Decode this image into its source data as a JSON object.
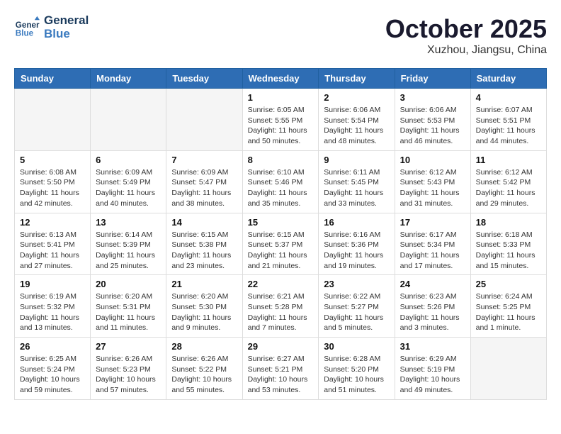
{
  "header": {
    "logo_line1": "General",
    "logo_line2": "Blue",
    "month_title": "October 2025",
    "location": "Xuzhou, Jiangsu, China"
  },
  "days_of_week": [
    "Sunday",
    "Monday",
    "Tuesday",
    "Wednesday",
    "Thursday",
    "Friday",
    "Saturday"
  ],
  "weeks": [
    [
      {
        "day": "",
        "empty": true
      },
      {
        "day": "",
        "empty": true
      },
      {
        "day": "",
        "empty": true
      },
      {
        "day": "1",
        "sunrise": "6:05 AM",
        "sunset": "5:55 PM",
        "daylight": "11 hours and 50 minutes."
      },
      {
        "day": "2",
        "sunrise": "6:06 AM",
        "sunset": "5:54 PM",
        "daylight": "11 hours and 48 minutes."
      },
      {
        "day": "3",
        "sunrise": "6:06 AM",
        "sunset": "5:53 PM",
        "daylight": "11 hours and 46 minutes."
      },
      {
        "day": "4",
        "sunrise": "6:07 AM",
        "sunset": "5:51 PM",
        "daylight": "11 hours and 44 minutes."
      }
    ],
    [
      {
        "day": "5",
        "sunrise": "6:08 AM",
        "sunset": "5:50 PM",
        "daylight": "11 hours and 42 minutes."
      },
      {
        "day": "6",
        "sunrise": "6:09 AM",
        "sunset": "5:49 PM",
        "daylight": "11 hours and 40 minutes."
      },
      {
        "day": "7",
        "sunrise": "6:09 AM",
        "sunset": "5:47 PM",
        "daylight": "11 hours and 38 minutes."
      },
      {
        "day": "8",
        "sunrise": "6:10 AM",
        "sunset": "5:46 PM",
        "daylight": "11 hours and 35 minutes."
      },
      {
        "day": "9",
        "sunrise": "6:11 AM",
        "sunset": "5:45 PM",
        "daylight": "11 hours and 33 minutes."
      },
      {
        "day": "10",
        "sunrise": "6:12 AM",
        "sunset": "5:43 PM",
        "daylight": "11 hours and 31 minutes."
      },
      {
        "day": "11",
        "sunrise": "6:12 AM",
        "sunset": "5:42 PM",
        "daylight": "11 hours and 29 minutes."
      }
    ],
    [
      {
        "day": "12",
        "sunrise": "6:13 AM",
        "sunset": "5:41 PM",
        "daylight": "11 hours and 27 minutes."
      },
      {
        "day": "13",
        "sunrise": "6:14 AM",
        "sunset": "5:39 PM",
        "daylight": "11 hours and 25 minutes."
      },
      {
        "day": "14",
        "sunrise": "6:15 AM",
        "sunset": "5:38 PM",
        "daylight": "11 hours and 23 minutes."
      },
      {
        "day": "15",
        "sunrise": "6:15 AM",
        "sunset": "5:37 PM",
        "daylight": "11 hours and 21 minutes."
      },
      {
        "day": "16",
        "sunrise": "6:16 AM",
        "sunset": "5:36 PM",
        "daylight": "11 hours and 19 minutes."
      },
      {
        "day": "17",
        "sunrise": "6:17 AM",
        "sunset": "5:34 PM",
        "daylight": "11 hours and 17 minutes."
      },
      {
        "day": "18",
        "sunrise": "6:18 AM",
        "sunset": "5:33 PM",
        "daylight": "11 hours and 15 minutes."
      }
    ],
    [
      {
        "day": "19",
        "sunrise": "6:19 AM",
        "sunset": "5:32 PM",
        "daylight": "11 hours and 13 minutes."
      },
      {
        "day": "20",
        "sunrise": "6:20 AM",
        "sunset": "5:31 PM",
        "daylight": "11 hours and 11 minutes."
      },
      {
        "day": "21",
        "sunrise": "6:20 AM",
        "sunset": "5:30 PM",
        "daylight": "11 hours and 9 minutes."
      },
      {
        "day": "22",
        "sunrise": "6:21 AM",
        "sunset": "5:28 PM",
        "daylight": "11 hours and 7 minutes."
      },
      {
        "day": "23",
        "sunrise": "6:22 AM",
        "sunset": "5:27 PM",
        "daylight": "11 hours and 5 minutes."
      },
      {
        "day": "24",
        "sunrise": "6:23 AM",
        "sunset": "5:26 PM",
        "daylight": "11 hours and 3 minutes."
      },
      {
        "day": "25",
        "sunrise": "6:24 AM",
        "sunset": "5:25 PM",
        "daylight": "11 hours and 1 minute."
      }
    ],
    [
      {
        "day": "26",
        "sunrise": "6:25 AM",
        "sunset": "5:24 PM",
        "daylight": "10 hours and 59 minutes."
      },
      {
        "day": "27",
        "sunrise": "6:26 AM",
        "sunset": "5:23 PM",
        "daylight": "10 hours and 57 minutes."
      },
      {
        "day": "28",
        "sunrise": "6:26 AM",
        "sunset": "5:22 PM",
        "daylight": "10 hours and 55 minutes."
      },
      {
        "day": "29",
        "sunrise": "6:27 AM",
        "sunset": "5:21 PM",
        "daylight": "10 hours and 53 minutes."
      },
      {
        "day": "30",
        "sunrise": "6:28 AM",
        "sunset": "5:20 PM",
        "daylight": "10 hours and 51 minutes."
      },
      {
        "day": "31",
        "sunrise": "6:29 AM",
        "sunset": "5:19 PM",
        "daylight": "10 hours and 49 minutes."
      },
      {
        "day": "",
        "empty": true
      }
    ]
  ]
}
